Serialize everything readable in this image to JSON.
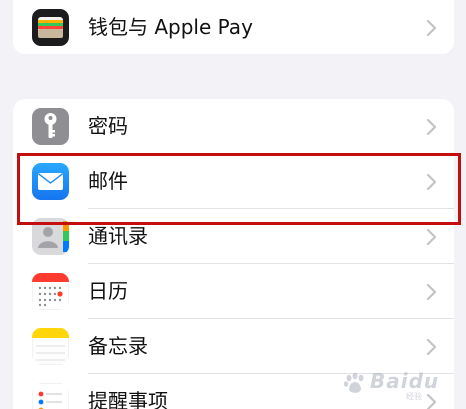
{
  "settings": {
    "wallet_row": {
      "label": "钱包与 Apple Pay",
      "icon": "wallet-icon"
    },
    "rows": [
      {
        "label": "密码",
        "icon": "passwords-key-icon"
      },
      {
        "label": "邮件",
        "icon": "mail-envelope-icon"
      },
      {
        "label": "通讯录",
        "icon": "contacts-icon"
      },
      {
        "label": "日历",
        "icon": "calendar-icon"
      },
      {
        "label": "备忘录",
        "icon": "notes-icon"
      },
      {
        "label": "提醒事项",
        "icon": "reminders-icon"
      }
    ]
  },
  "annotation": {
    "highlight_color": "#c40e0e",
    "highlighted_item": "邮件"
  },
  "watermark": {
    "text": "Baidu",
    "sub_text": "经验"
  },
  "colors": {
    "background": "#f2f2f7",
    "cell": "#ffffff",
    "chevron": "#c4c4c7",
    "mail_blue": "#1e8cf5",
    "passwords_gray": "#8e8e93",
    "calendar_red": "#ff3b30",
    "notes_yellow": "#ffd60a"
  }
}
